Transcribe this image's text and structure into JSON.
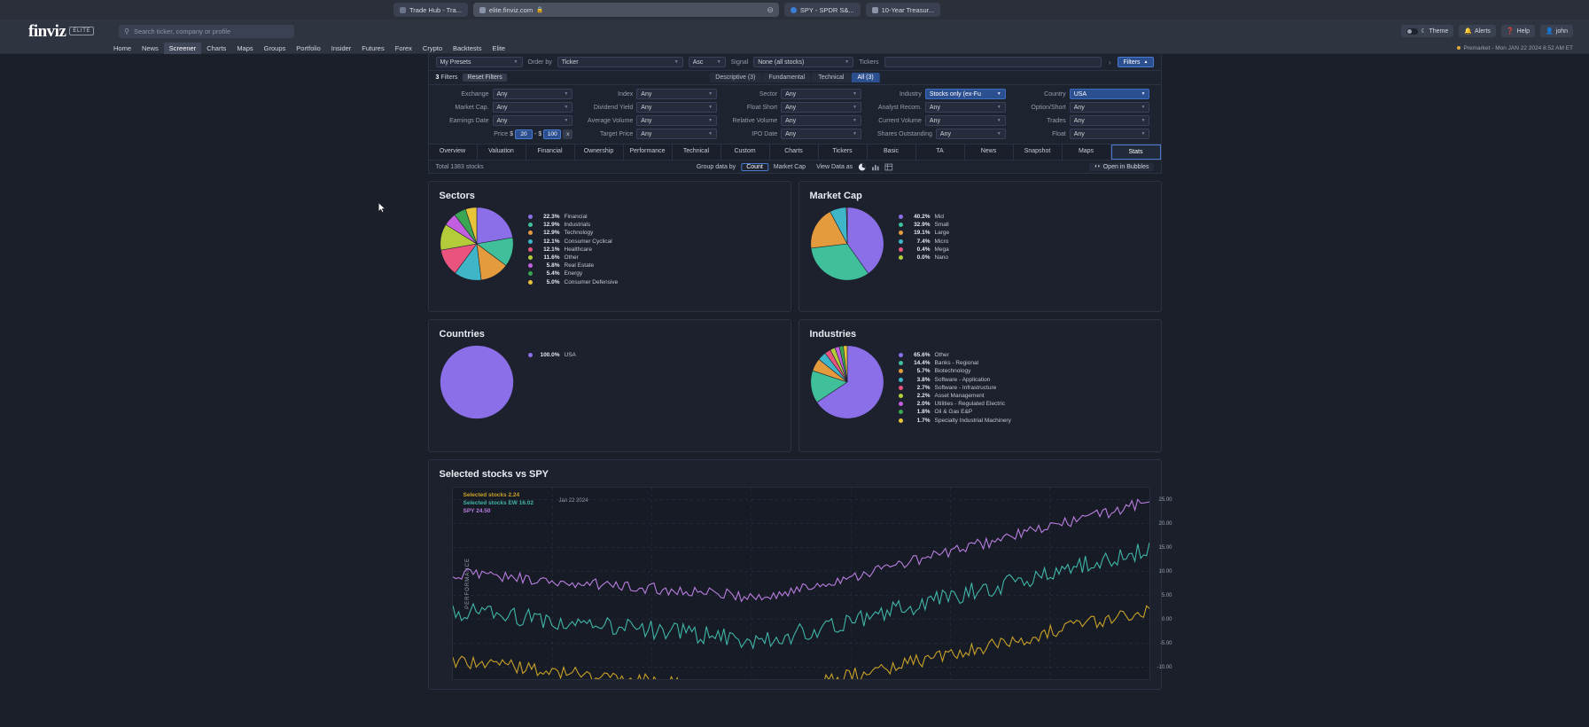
{
  "browser": {
    "tabs": [
      {
        "title": "Trade Hub - Tra...",
        "icon": "globe-icon",
        "active": false
      },
      {
        "title": "elite.finviz.com",
        "icon": "page-icon",
        "lock": "lock-icon",
        "active": true
      },
      {
        "title": "SPY - SPDR S&...",
        "icon": "facebook-icon",
        "active": false
      },
      {
        "title": "10-Year Treasur...",
        "icon": "image-icon",
        "active": false
      }
    ],
    "url_end_glyph": "minus-circle-icon"
  },
  "header": {
    "logo": "finviz",
    "elite_badge": "ELITE",
    "search_placeholder": "Search ticker, company or profile",
    "search_icon": "search-icon",
    "theme_label": "Theme",
    "alerts_label": "Alerts",
    "help_label": "Help",
    "user_label": "john",
    "premarket": "Premarket - Mon JAN 22 2024 8:52 AM ET"
  },
  "nav": {
    "items": [
      "Home",
      "News",
      "Screener",
      "Charts",
      "Maps",
      "Groups",
      "Portfolio",
      "Insider",
      "Futures",
      "Forex",
      "Crypto",
      "Backtests",
      "Elite"
    ],
    "active": "Screener"
  },
  "screener": {
    "presets_value": "My Presets",
    "order_by_label": "Order by",
    "order_by_value": "Ticker",
    "direction_value": "Asc",
    "signal_label": "Signal",
    "signal_value": "None (all stocks)",
    "tickers_label": "Tickers",
    "tickers_value": "",
    "filters_button": "Filters",
    "filters_count": "3",
    "filters_count_label": "Filters",
    "reset_filters": "Reset Filters",
    "filter_tabs": [
      {
        "label": "Descriptive (3)",
        "active": false
      },
      {
        "label": "Fundamental",
        "active": false
      },
      {
        "label": "Technical",
        "active": false
      },
      {
        "label": "All (3)",
        "active": true
      }
    ],
    "filters": [
      [
        {
          "label": "Exchange",
          "value": "Any",
          "highlight": false
        },
        {
          "label": "Index",
          "value": "Any",
          "highlight": false
        },
        {
          "label": "Sector",
          "value": "Any",
          "highlight": false
        },
        {
          "label": "Industry",
          "value": "Stocks only (ex-Fu",
          "highlight": true
        },
        {
          "label": "Country",
          "value": "USA",
          "highlight": true
        }
      ],
      [
        {
          "label": "Market Cap.",
          "value": "Any",
          "highlight": false
        },
        {
          "label": "Dividend Yield",
          "value": "Any",
          "highlight": false
        },
        {
          "label": "Float Short",
          "value": "Any",
          "highlight": false
        },
        {
          "label": "Analyst Recom.",
          "value": "Any",
          "highlight": false
        },
        {
          "label": "Option/Short",
          "value": "Any",
          "highlight": false
        }
      ],
      [
        {
          "label": "Earnings Date",
          "value": "Any",
          "highlight": false
        },
        {
          "label": "Average Volume",
          "value": "Any",
          "highlight": false
        },
        {
          "label": "Relative Volume",
          "value": "Any",
          "highlight": false
        },
        {
          "label": "Current Volume",
          "value": "Any",
          "highlight": false
        },
        {
          "label": "Trades",
          "value": "Any",
          "highlight": false
        }
      ]
    ],
    "price_row": {
      "label": "Price",
      "currency": "$",
      "min": "20",
      "dash": "-",
      "max": "100",
      "clear": "x"
    },
    "price_row_rest": [
      {
        "label": "Target Price",
        "value": "Any"
      },
      {
        "label": "IPO Date",
        "value": "Any"
      },
      {
        "label": "Shares Outstanding",
        "value": "Any"
      },
      {
        "label": "Float",
        "value": "Any"
      }
    ],
    "view_tabs": [
      "Overview",
      "Valuation",
      "Financial",
      "Ownership",
      "Performance",
      "Technical",
      "Custom",
      "Charts",
      "Tickers",
      "Basic",
      "TA",
      "News",
      "Snapshot",
      "Maps",
      "Stats"
    ],
    "view_tab_active": "Stats",
    "total_label": "Total 1383 stocks",
    "group_data_by_label": "Group data by",
    "group_by_options": [
      "Count",
      "Market Cap"
    ],
    "group_by_active": "Count",
    "view_data_as_label": "View Data as",
    "view_data_icons": [
      "pie-chart-icon",
      "bar-chart-icon",
      "table-icon"
    ],
    "view_data_active": "pie-chart-icon",
    "open_in_bubbles": "Open in Bubbles"
  },
  "cards": [
    {
      "title": "Sectors",
      "chart_data": {
        "type": "pie",
        "title": "Sectors",
        "legend_position": "right",
        "categories": [
          "Financial",
          "Industrials",
          "Technology",
          "Consumer Cyclical",
          "Healthcare",
          "Other",
          "Real Estate",
          "Energy",
          "Consumer Defensive"
        ],
        "values": [
          22.3,
          12.9,
          12.9,
          12.1,
          12.1,
          11.6,
          5.8,
          5.4,
          5.0
        ],
        "labels": [
          "22.3%",
          "12.9%",
          "12.9%",
          "12.1%",
          "12.1%",
          "11.6%",
          "5.8%",
          "5.4%",
          "5.0%"
        ],
        "colors": [
          "#8b6fe8",
          "#3fbf9a",
          "#e39b3e",
          "#3fb6c8",
          "#e8547e",
          "#b5cc3a",
          "#c25fe0",
          "#3aa653",
          "#e8c43a"
        ]
      }
    },
    {
      "title": "Market Cap",
      "chart_data": {
        "type": "pie",
        "title": "Market Cap",
        "legend_position": "right",
        "categories": [
          "Mid",
          "Small",
          "Large",
          "Micro",
          "Mega",
          "Nano"
        ],
        "values": [
          40.2,
          32.9,
          19.1,
          7.4,
          0.4,
          0.0
        ],
        "labels": [
          "40.2%",
          "32.9%",
          "19.1%",
          "7.4%",
          "0.4%",
          "0.0%"
        ],
        "colors": [
          "#8b6fe8",
          "#3fbf9a",
          "#e39b3e",
          "#3fb6c8",
          "#e8547e",
          "#b5cc3a"
        ]
      }
    },
    {
      "title": "Countries",
      "chart_data": {
        "type": "pie",
        "title": "Countries",
        "legend_position": "right",
        "categories": [
          "USA"
        ],
        "values": [
          100.0
        ],
        "labels": [
          "100.0%"
        ],
        "colors": [
          "#8b6fe8"
        ]
      }
    },
    {
      "title": "Industries",
      "chart_data": {
        "type": "pie",
        "title": "Industries",
        "legend_position": "right",
        "categories": [
          "Other",
          "Banks - Regional",
          "Biotechnology",
          "Software - Application",
          "Software - Infrastructure",
          "Asset Management",
          "Utilities - Regulated Electric",
          "Oil & Gas E&P",
          "Specialty Industrial Machinery"
        ],
        "values": [
          65.6,
          14.4,
          5.7,
          3.8,
          2.7,
          2.2,
          2.0,
          1.8,
          1.7
        ],
        "labels": [
          "65.6%",
          "14.4%",
          "5.7%",
          "3.8%",
          "2.7%",
          "2.2%",
          "2.0%",
          "1.8%",
          "1.7%"
        ],
        "colors": [
          "#8b6fe8",
          "#3fbf9a",
          "#e39b3e",
          "#3fb6c8",
          "#e8547e",
          "#b5cc3a",
          "#c25fe0",
          "#3aa653",
          "#e8c43a"
        ]
      }
    }
  ],
  "performance": {
    "title": "Selected stocks vs SPY",
    "axis_label": "PERFORMANCE",
    "date_annotation": "Jan 22 2024",
    "chart_data": {
      "type": "line",
      "title": "Selected stocks vs SPY",
      "ylabel": "PERFORMANCE",
      "xlabel": "",
      "grid": true,
      "ylim": [
        -12.5,
        27.5
      ],
      "yticks": [
        "25.00",
        "20.00",
        "15.00",
        "10.00",
        "5.00",
        "0.00",
        "-5.00",
        "-10.00"
      ],
      "ytick_values": [
        25,
        20,
        15,
        10,
        5,
        0,
        -5,
        -10
      ],
      "legend_position": "top-left",
      "series": [
        {
          "name": "Selected stocks",
          "last_value": "2.24",
          "value": 2.24,
          "color": "#c9a227"
        },
        {
          "name": "Selected stocks EW",
          "last_value": "16.02",
          "value": 16.02,
          "color": "#3fb6a8"
        },
        {
          "name": "SPY",
          "last_value": "24.50",
          "value": 24.5,
          "color": "#b97ee0"
        }
      ]
    }
  }
}
